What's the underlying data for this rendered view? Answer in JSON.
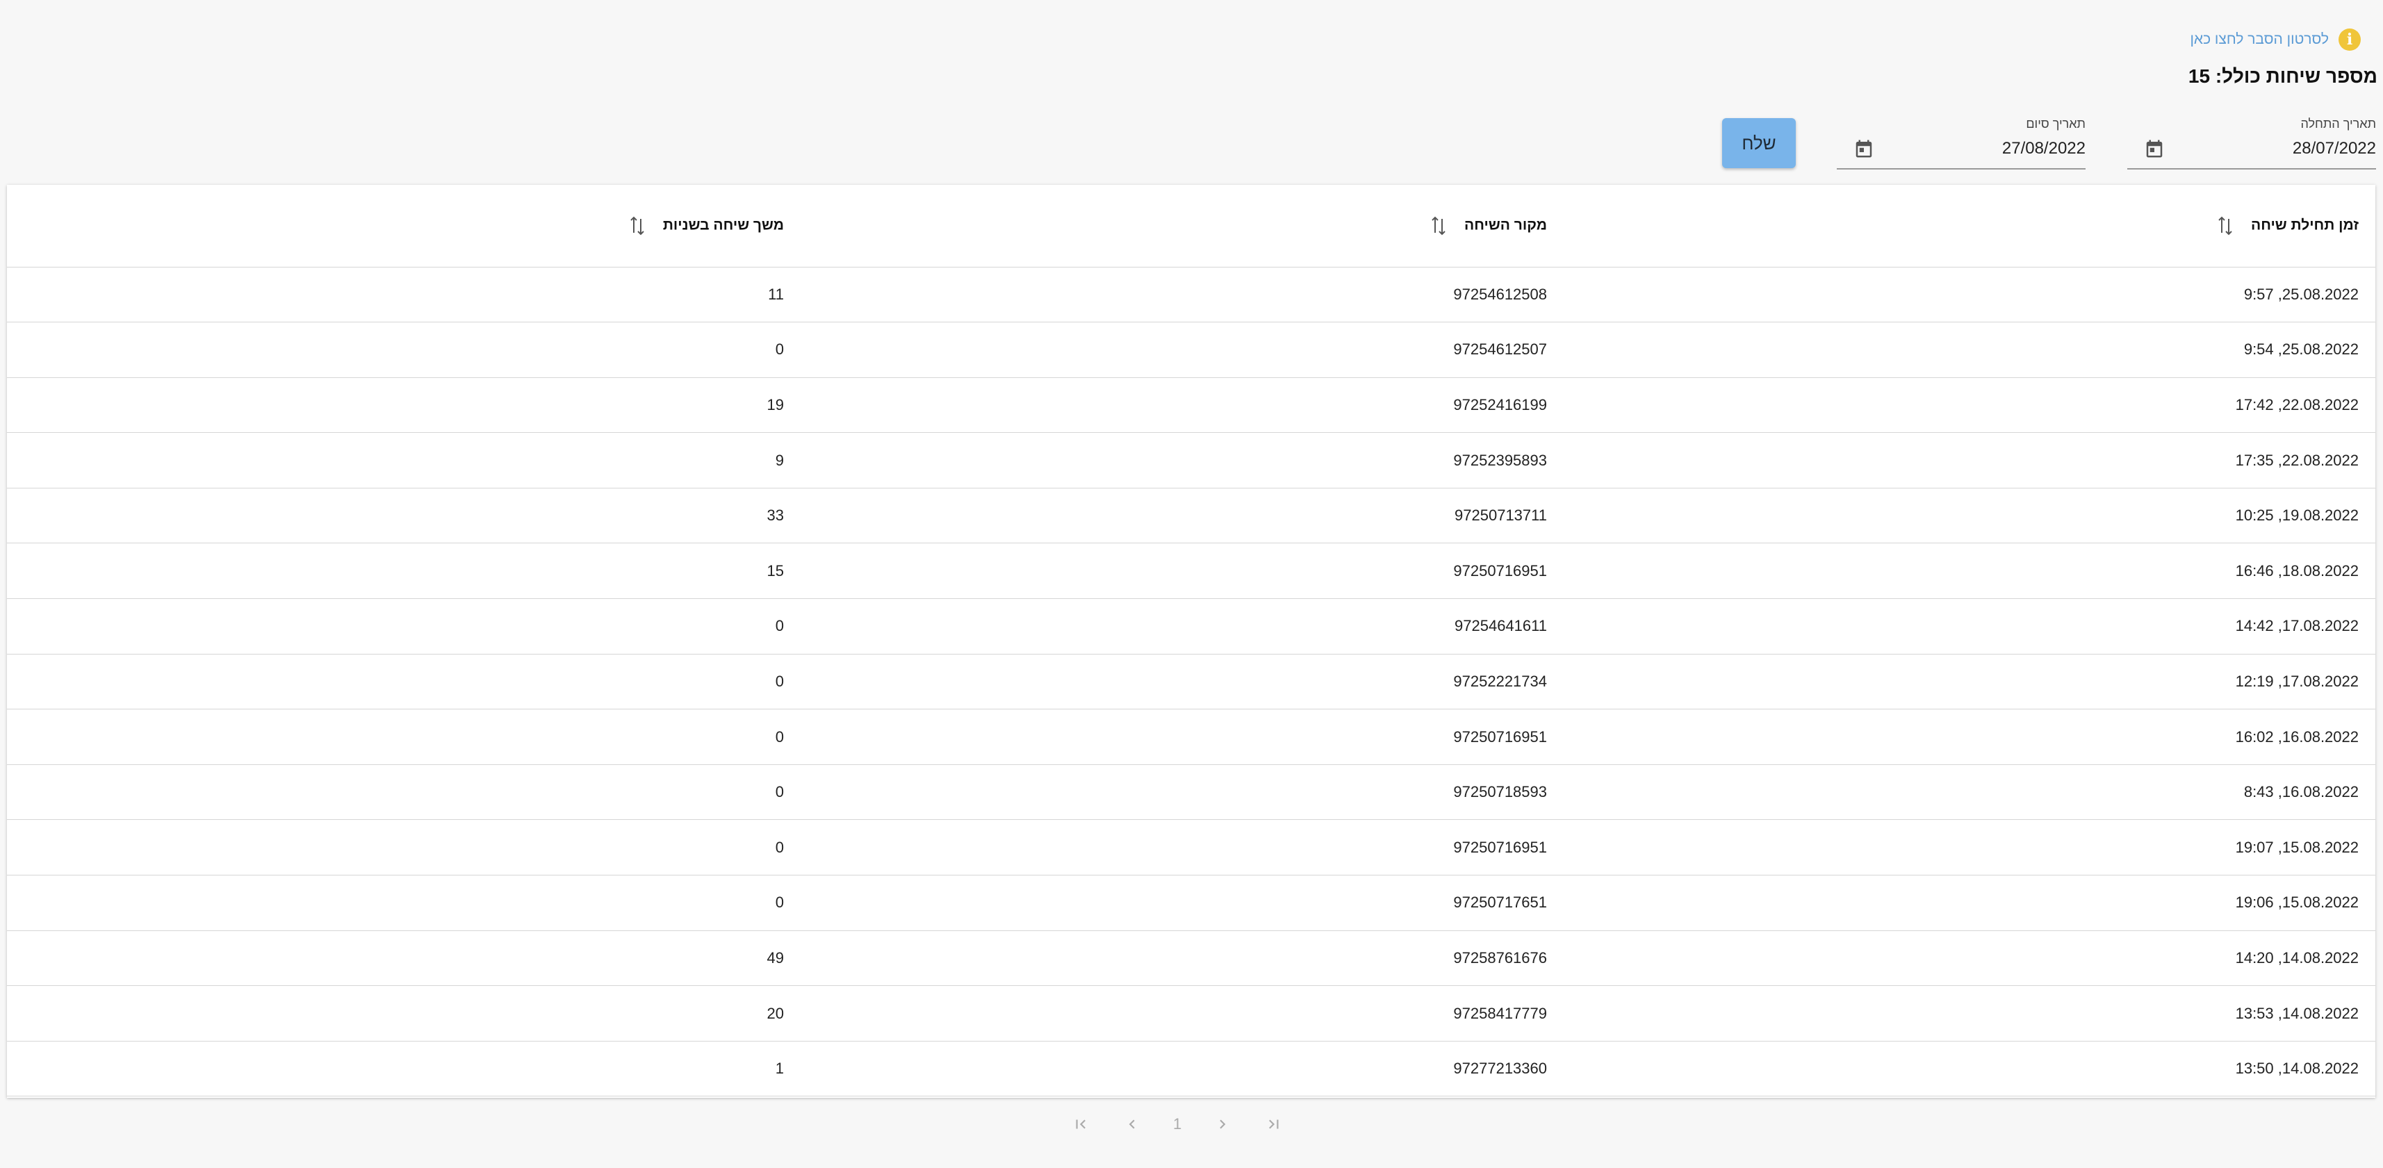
{
  "info": {
    "link_text": "לסרטון הסבר לחצו כאן"
  },
  "summary": {
    "title": "מספר שיחות כולל: 15"
  },
  "filters": {
    "start_label": "תאריך התחלה",
    "start_value": "28/07/2022",
    "end_label": "תאריך סיום",
    "end_value": "27/08/2022",
    "submit_label": "שלח"
  },
  "table": {
    "columns": [
      "זמן תחילת שיחה",
      "מקור השיחה",
      "משך שיחה בשניות"
    ],
    "rows": [
      [
        "25.08.2022, 9:57",
        "97254612508",
        "11"
      ],
      [
        "25.08.2022, 9:54",
        "97254612507",
        "0"
      ],
      [
        "22.08.2022, 17:42",
        "97252416199",
        "19"
      ],
      [
        "22.08.2022, 17:35",
        "97252395893",
        "9"
      ],
      [
        "19.08.2022, 10:25",
        "97250713711",
        "33"
      ],
      [
        "18.08.2022, 16:46",
        "97250716951",
        "15"
      ],
      [
        "17.08.2022, 14:42",
        "97254641611",
        "0"
      ],
      [
        "17.08.2022, 12:19",
        "97252221734",
        "0"
      ],
      [
        "16.08.2022, 16:02",
        "97250716951",
        "0"
      ],
      [
        "16.08.2022, 8:43",
        "97250718593",
        "0"
      ],
      [
        "15.08.2022, 19:07",
        "97250716951",
        "0"
      ],
      [
        "15.08.2022, 19:06",
        "97250717651",
        "0"
      ],
      [
        "14.08.2022, 14:20",
        "97258761676",
        "49"
      ],
      [
        "14.08.2022, 13:53",
        "97258417779",
        "20"
      ],
      [
        "14.08.2022, 13:50",
        "97277213360",
        "1"
      ]
    ]
  },
  "pagination": {
    "current_page": "1"
  }
}
